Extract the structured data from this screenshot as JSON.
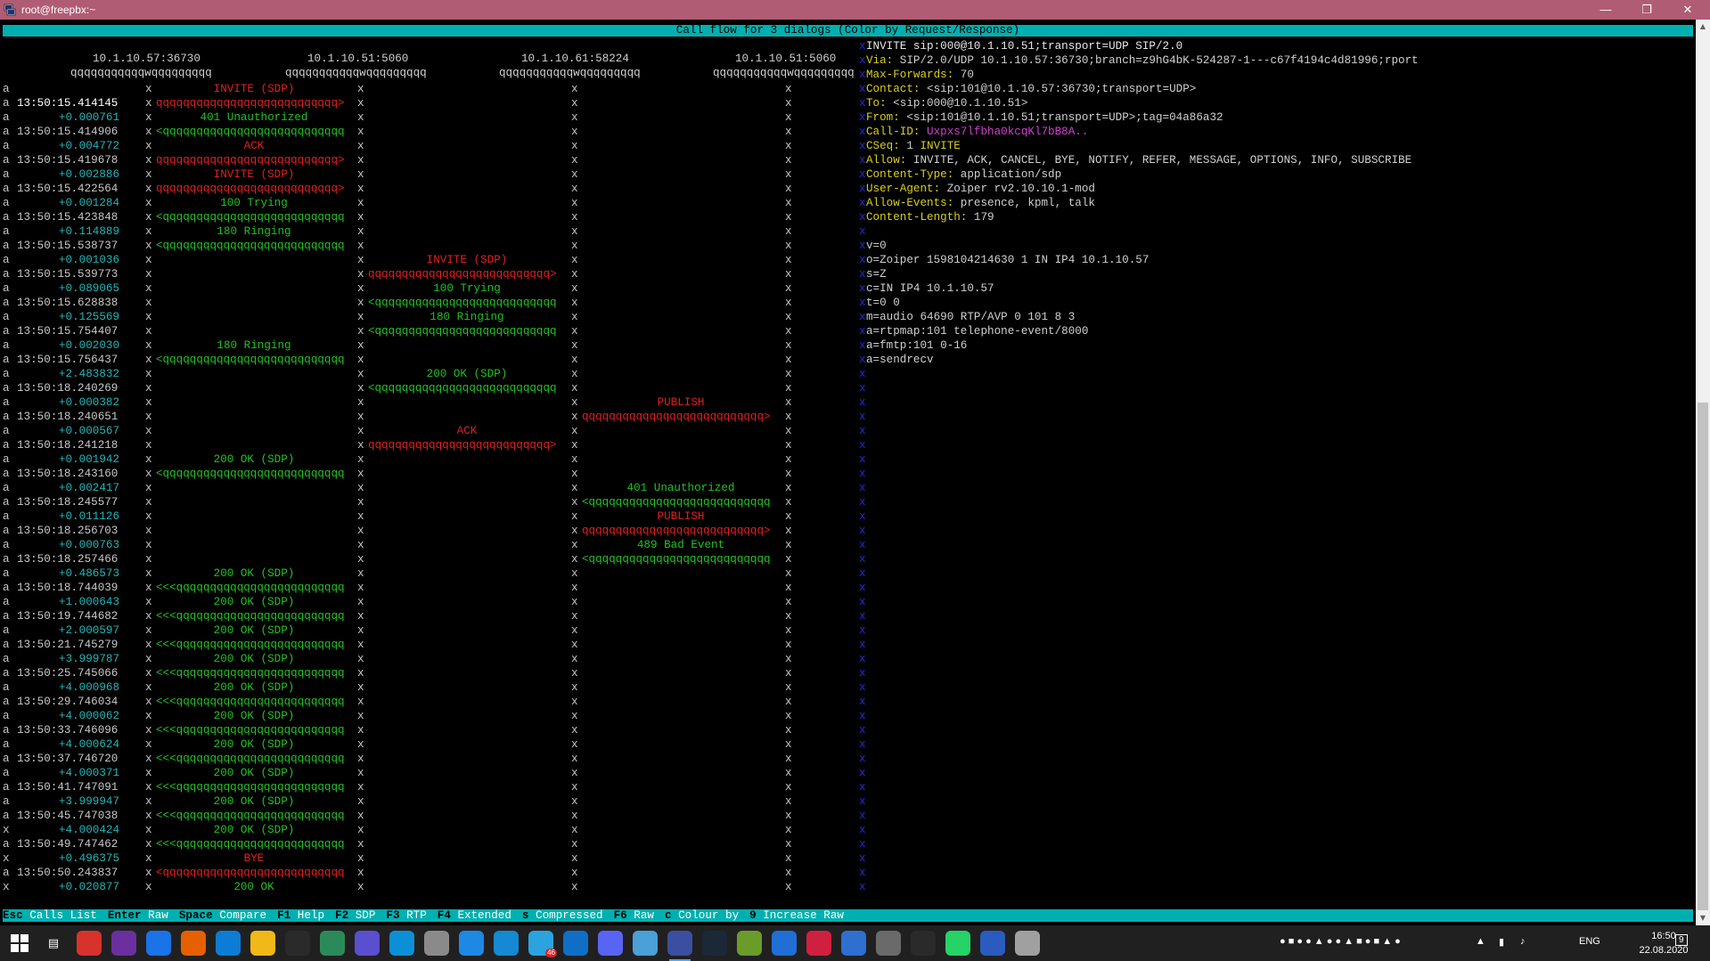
{
  "window": {
    "title": "root@freepbx:~",
    "min_icon": "minimize-icon",
    "max_icon": "restore-icon",
    "close_icon": "close-icon"
  },
  "header": {
    "text": "Call flow for 3 dialogs (Color by Request/Response)"
  },
  "endpoints": [
    "10.1.10.57:36730",
    "10.1.10.51:5060",
    "10.1.10.61:58224",
    "10.1.10.51:5060"
  ],
  "lifeline": "qqqqqqqqqqqwqqqqqqqqq",
  "flow": [
    {
      "flag": "a",
      "time": "",
      "delta": "",
      "from": 0,
      "to": 1,
      "label": "INVITE (SDP)",
      "color": "red",
      "head": "> ",
      "arrow": ""
    },
    {
      "flag": "a",
      "time": "13:50:15.414145",
      "delta": "",
      "from": 0,
      "to": 1,
      "label": "",
      "color": "red",
      "arrow": "qqqqqqqqqqqqqqqqqqqqqqqqqqq>"
    },
    {
      "flag": "a",
      "time": "",
      "delta": "+0.000761",
      "from": 0,
      "to": 1,
      "label": "401 Unauthorized",
      "color": "green",
      "arrow": ""
    },
    {
      "flag": "a",
      "time": "13:50:15.414906",
      "delta": "",
      "from": 0,
      "to": 1,
      "label": "",
      "color": "green",
      "arrow": "<qqqqqqqqqqqqqqqqqqqqqqqqqqq"
    },
    {
      "flag": "a",
      "time": "",
      "delta": "+0.004772",
      "from": 0,
      "to": 1,
      "label": "ACK",
      "color": "red",
      "arrow": ""
    },
    {
      "flag": "a",
      "time": "13:50:15.419678",
      "delta": "",
      "from": 0,
      "to": 1,
      "label": "",
      "color": "red",
      "arrow": "qqqqqqqqqqqqqqqqqqqqqqqqqqq>"
    },
    {
      "flag": "a",
      "time": "",
      "delta": "+0.002886",
      "from": 0,
      "to": 1,
      "label": "INVITE (SDP)",
      "color": "red",
      "arrow": ""
    },
    {
      "flag": "a",
      "time": "13:50:15.422564",
      "delta": "",
      "from": 0,
      "to": 1,
      "label": "",
      "color": "red",
      "arrow": "qqqqqqqqqqqqqqqqqqqqqqqqqqq>"
    },
    {
      "flag": "a",
      "time": "",
      "delta": "+0.001284",
      "from": 0,
      "to": 1,
      "label": "100 Trying",
      "color": "green",
      "arrow": ""
    },
    {
      "flag": "a",
      "time": "13:50:15.423848",
      "delta": "",
      "from": 0,
      "to": 1,
      "label": "",
      "color": "green",
      "arrow": "<qqqqqqqqqqqqqqqqqqqqqqqqqqq"
    },
    {
      "flag": "a",
      "time": "",
      "delta": "+0.114889",
      "from": 0,
      "to": 1,
      "label": "180 Ringing",
      "color": "green",
      "arrow": ""
    },
    {
      "flag": "a",
      "time": "13:50:15.538737",
      "delta": "",
      "from": 0,
      "to": 1,
      "label": "",
      "color": "green",
      "arrow": "<qqqqqqqqqqqqqqqqqqqqqqqqqqq"
    },
    {
      "flag": "a",
      "time": "",
      "delta": "+0.001036",
      "from": 1,
      "to": 2,
      "label": "INVITE (SDP)",
      "color": "red",
      "arrow": ""
    },
    {
      "flag": "a",
      "time": "13:50:15.539773",
      "delta": "",
      "from": 1,
      "to": 2,
      "label": "",
      "color": "red",
      "arrow": "qqqqqqqqqqqqqqqqqqqqqqqqqqq>"
    },
    {
      "flag": "a",
      "time": "",
      "delta": "+0.089065",
      "from": 1,
      "to": 2,
      "label": "100 Trying",
      "color": "green",
      "arrow": ""
    },
    {
      "flag": "a",
      "time": "13:50:15.628838",
      "delta": "",
      "from": 1,
      "to": 2,
      "label": "",
      "color": "green",
      "arrow": "<qqqqqqqqqqqqqqqqqqqqqqqqqqq"
    },
    {
      "flag": "a",
      "time": "",
      "delta": "+0.125569",
      "from": 1,
      "to": 2,
      "label": "180 Ringing",
      "color": "green",
      "arrow": ""
    },
    {
      "flag": "a",
      "time": "13:50:15.754407",
      "delta": "",
      "from": 1,
      "to": 2,
      "label": "",
      "color": "green",
      "arrow": "<qqqqqqqqqqqqqqqqqqqqqqqqqqq"
    },
    {
      "flag": "a",
      "time": "",
      "delta": "+0.002030",
      "from": 0,
      "to": 1,
      "label": "180 Ringing",
      "color": "green",
      "arrow": ""
    },
    {
      "flag": "a",
      "time": "13:50:15.756437",
      "delta": "",
      "from": 0,
      "to": 1,
      "label": "",
      "color": "green",
      "arrow": "<qqqqqqqqqqqqqqqqqqqqqqqqqqq"
    },
    {
      "flag": "a",
      "time": "",
      "delta": "+2.483832",
      "from": 1,
      "to": 2,
      "label": "200 OK (SDP)",
      "color": "green",
      "arrow": ""
    },
    {
      "flag": "a",
      "time": "13:50:18.240269",
      "delta": "",
      "from": 1,
      "to": 2,
      "label": "",
      "color": "green",
      "arrow": "<qqqqqqqqqqqqqqqqqqqqqqqqqqq"
    },
    {
      "flag": "a",
      "time": "",
      "delta": "+0.000382",
      "from": 2,
      "to": 3,
      "label": "PUBLISH",
      "color": "red",
      "arrow": ""
    },
    {
      "flag": "a",
      "time": "13:50:18.240651",
      "delta": "",
      "from": 2,
      "to": 3,
      "label": "",
      "color": "red",
      "arrow": "qqqqqqqqqqqqqqqqqqqqqqqqqqq>"
    },
    {
      "flag": "a",
      "time": "",
      "delta": "+0.000567",
      "from": 1,
      "to": 2,
      "label": "ACK",
      "color": "red",
      "arrow": ""
    },
    {
      "flag": "a",
      "time": "13:50:18.241218",
      "delta": "",
      "from": 1,
      "to": 2,
      "label": "",
      "color": "red",
      "arrow": "qqqqqqqqqqqqqqqqqqqqqqqqqqq>"
    },
    {
      "flag": "a",
      "time": "",
      "delta": "+0.001942",
      "from": 0,
      "to": 1,
      "label": "200 OK (SDP)",
      "color": "green",
      "arrow": ""
    },
    {
      "flag": "a",
      "time": "13:50:18.243160",
      "delta": "",
      "from": 0,
      "to": 1,
      "label": "",
      "color": "green",
      "arrow": "<qqqqqqqqqqqqqqqqqqqqqqqqqqq"
    },
    {
      "flag": "a",
      "time": "",
      "delta": "+0.002417",
      "from": 2,
      "to": 3,
      "label": "401 Unauthorized",
      "color": "green",
      "arrow": ""
    },
    {
      "flag": "a",
      "time": "13:50:18.245577",
      "delta": "",
      "from": 2,
      "to": 3,
      "label": "",
      "color": "green",
      "arrow": "<qqqqqqqqqqqqqqqqqqqqqqqqqqq"
    },
    {
      "flag": "a",
      "time": "",
      "delta": "+0.011126",
      "from": 2,
      "to": 3,
      "label": "PUBLISH",
      "color": "red",
      "arrow": ""
    },
    {
      "flag": "a",
      "time": "13:50:18.256703",
      "delta": "",
      "from": 2,
      "to": 3,
      "label": "",
      "color": "red",
      "arrow": "qqqqqqqqqqqqqqqqqqqqqqqqqqq>"
    },
    {
      "flag": "a",
      "time": "",
      "delta": "+0.000763",
      "from": 2,
      "to": 3,
      "label": "489 Bad Event",
      "color": "green",
      "arrow": ""
    },
    {
      "flag": "a",
      "time": "13:50:18.257466",
      "delta": "",
      "from": 2,
      "to": 3,
      "label": "",
      "color": "green",
      "arrow": "<qqqqqqqqqqqqqqqqqqqqqqqqqqq"
    },
    {
      "flag": "a",
      "time": "",
      "delta": "+0.486573",
      "from": 0,
      "to": 1,
      "label": "200 OK (SDP)",
      "color": "green",
      "arrow": ""
    },
    {
      "flag": "a",
      "time": "13:50:18.744039",
      "delta": "",
      "from": 0,
      "to": 1,
      "label": "",
      "color": "green",
      "arrow": "<<<qqqqqqqqqqqqqqqqqqqqqqqqq"
    },
    {
      "flag": "a",
      "time": "",
      "delta": "+1.000643",
      "from": 0,
      "to": 1,
      "label": "200 OK (SDP)",
      "color": "green",
      "arrow": ""
    },
    {
      "flag": "a",
      "time": "13:50:19.744682",
      "delta": "",
      "from": 0,
      "to": 1,
      "label": "",
      "color": "green",
      "arrow": "<<<qqqqqqqqqqqqqqqqqqqqqqqqq"
    },
    {
      "flag": "a",
      "time": "",
      "delta": "+2.000597",
      "from": 0,
      "to": 1,
      "label": "200 OK (SDP)",
      "color": "green",
      "arrow": ""
    },
    {
      "flag": "a",
      "time": "13:50:21.745279",
      "delta": "",
      "from": 0,
      "to": 1,
      "label": "",
      "color": "green",
      "arrow": "<<<qqqqqqqqqqqqqqqqqqqqqqqqq"
    },
    {
      "flag": "a",
      "time": "",
      "delta": "+3.999787",
      "from": 0,
      "to": 1,
      "label": "200 OK (SDP)",
      "color": "green",
      "arrow": ""
    },
    {
      "flag": "a",
      "time": "13:50:25.745066",
      "delta": "",
      "from": 0,
      "to": 1,
      "label": "",
      "color": "green",
      "arrow": "<<<qqqqqqqqqqqqqqqqqqqqqqqqq"
    },
    {
      "flag": "a",
      "time": "",
      "delta": "+4.000968",
      "from": 0,
      "to": 1,
      "label": "200 OK (SDP)",
      "color": "green",
      "arrow": ""
    },
    {
      "flag": "a",
      "time": "13:50:29.746034",
      "delta": "",
      "from": 0,
      "to": 1,
      "label": "",
      "color": "green",
      "arrow": "<<<qqqqqqqqqqqqqqqqqqqqqqqqq"
    },
    {
      "flag": "a",
      "time": "",
      "delta": "+4.000062",
      "from": 0,
      "to": 1,
      "label": "200 OK (SDP)",
      "color": "green",
      "arrow": ""
    },
    {
      "flag": "a",
      "time": "13:50:33.746096",
      "delta": "",
      "from": 0,
      "to": 1,
      "label": "",
      "color": "green",
      "arrow": "<<<qqqqqqqqqqqqqqqqqqqqqqqqq"
    },
    {
      "flag": "a",
      "time": "",
      "delta": "+4.000624",
      "from": 0,
      "to": 1,
      "label": "200 OK (SDP)",
      "color": "green",
      "arrow": ""
    },
    {
      "flag": "a",
      "time": "13:50:37.746720",
      "delta": "",
      "from": 0,
      "to": 1,
      "label": "",
      "color": "green",
      "arrow": "<<<qqqqqqqqqqqqqqqqqqqqqqqqq"
    },
    {
      "flag": "a",
      "time": "",
      "delta": "+4.000371",
      "from": 0,
      "to": 1,
      "label": "200 OK (SDP)",
      "color": "green",
      "arrow": ""
    },
    {
      "flag": "a",
      "time": "13:50:41.747091",
      "delta": "",
      "from": 0,
      "to": 1,
      "label": "",
      "color": "green",
      "arrow": "<<<qqqqqqqqqqqqqqqqqqqqqqqqq"
    },
    {
      "flag": "a",
      "time": "",
      "delta": "+3.999947",
      "from": 0,
      "to": 1,
      "label": "200 OK (SDP)",
      "color": "green",
      "arrow": ""
    },
    {
      "flag": "a",
      "time": "13:50:45.747038",
      "delta": "",
      "from": 0,
      "to": 1,
      "label": "",
      "color": "green",
      "arrow": "<<<qqqqqqqqqqqqqqqqqqqqqqqqq"
    },
    {
      "flag": "x",
      "time": "",
      "delta": "+4.000424",
      "from": 0,
      "to": 1,
      "label": "200 OK (SDP)",
      "color": "green",
      "arrow": ""
    },
    {
      "flag": "a",
      "time": "13:50:49.747462",
      "delta": "",
      "from": 0,
      "to": 1,
      "label": "",
      "color": "green",
      "arrow": "<<<qqqqqqqqqqqqqqqqqqqqqqqqq"
    },
    {
      "flag": "x",
      "time": "",
      "delta": "+0.496375",
      "from": 0,
      "to": 1,
      "label": "BYE",
      "color": "red",
      "arrow": ""
    },
    {
      "flag": "a",
      "time": "13:50:50.243837",
      "delta": "",
      "from": 0,
      "to": 1,
      "label": "",
      "color": "red",
      "arrow": "<qqqqqqqqqqqqqqqqqqqqqqqqqqq"
    },
    {
      "flag": "x",
      "time": "",
      "delta": "+0.020877",
      "from": 0,
      "to": 1,
      "label": "200 OK",
      "color": "green",
      "arrow": ""
    }
  ],
  "detail": [
    {
      "parts": [
        {
          "t": "INVITE sip:000@10.1.10.51;transport=UDP SIP/2.0",
          "c": "y"
        }
      ]
    },
    {
      "parts": [
        {
          "t": "Via:",
          "c": "k"
        },
        {
          "t": " SIP/2.0/UDP 10.1.10.57:36730;branch=z9hG4bK-524287-1---c67f4194c4d81996;rport",
          "c": ""
        }
      ]
    },
    {
      "parts": [
        {
          "t": "Max-Forwards:",
          "c": "k"
        },
        {
          "t": " 70",
          "c": ""
        }
      ]
    },
    {
      "parts": [
        {
          "t": "Contact:",
          "c": "k"
        },
        {
          "t": " <sip:101@10.1.10.57:36730;transport=UDP>",
          "c": ""
        }
      ]
    },
    {
      "parts": [
        {
          "t": "To:",
          "c": "k"
        },
        {
          "t": " <sip:000@10.1.10.51>",
          "c": ""
        }
      ]
    },
    {
      "parts": [
        {
          "t": "From:",
          "c": "k"
        },
        {
          "t": " <sip:101@10.1.10.51;transport=UDP>;tag=04a86a32",
          "c": ""
        }
      ]
    },
    {
      "parts": [
        {
          "t": "Call-ID:",
          "c": "k"
        },
        {
          "t": " Uxpxs7lfbha0kcqKl7bB8A..",
          "c": "m"
        }
      ]
    },
    {
      "parts": [
        {
          "t": "CSeq:",
          "c": "k"
        },
        {
          "t": " 1 ",
          "c": ""
        },
        {
          "t": "INVITE",
          "c": "k"
        }
      ]
    },
    {
      "parts": [
        {
          "t": "Allow:",
          "c": "k"
        },
        {
          "t": " INVITE, ACK, CANCEL, BYE, NOTIFY, REFER, MESSAGE, OPTIONS, INFO, SUBSCRIBE",
          "c": ""
        }
      ]
    },
    {
      "parts": [
        {
          "t": "Content-Type:",
          "c": "k"
        },
        {
          "t": " application/sdp",
          "c": ""
        }
      ]
    },
    {
      "parts": [
        {
          "t": "User-Agent:",
          "c": "k"
        },
        {
          "t": " Zoiper rv2.10.10.1-mod",
          "c": ""
        }
      ]
    },
    {
      "parts": [
        {
          "t": "Allow-Events:",
          "c": "k"
        },
        {
          "t": " presence, kpml, talk",
          "c": ""
        }
      ]
    },
    {
      "parts": [
        {
          "t": "Content-Length:",
          "c": "k"
        },
        {
          "t": " 179",
          "c": ""
        }
      ]
    },
    {
      "parts": []
    },
    {
      "parts": [
        {
          "t": "v=0",
          "c": ""
        }
      ]
    },
    {
      "parts": [
        {
          "t": "o=Zoiper 1598104214630 1 IN IP4 10.1.10.57",
          "c": ""
        }
      ]
    },
    {
      "parts": [
        {
          "t": "s=Z",
          "c": ""
        }
      ]
    },
    {
      "parts": [
        {
          "t": "c=IN IP4 10.1.10.57",
          "c": ""
        }
      ]
    },
    {
      "parts": [
        {
          "t": "t=0 0",
          "c": ""
        }
      ]
    },
    {
      "parts": [
        {
          "t": "m=audio 64690 RTP/AVP 0 101 8 3",
          "c": ""
        }
      ]
    },
    {
      "parts": [
        {
          "t": "a=rtpmap:101 telephone-event/8000",
          "c": ""
        }
      ]
    },
    {
      "parts": [
        {
          "t": "a=fmtp:101 0-16",
          "c": ""
        }
      ]
    },
    {
      "parts": [
        {
          "t": "a=sendrecv",
          "c": ""
        }
      ]
    }
  ],
  "detail_separator": "x",
  "footer": [
    {
      "key": "Esc",
      "label": "Calls List"
    },
    {
      "key": "Enter",
      "label": "Raw"
    },
    {
      "key": "Space",
      "label": "Compare"
    },
    {
      "key": "F1",
      "label": "Help"
    },
    {
      "key": "F2",
      "label": "SDP"
    },
    {
      "key": "F3",
      "label": "RTP"
    },
    {
      "key": "F4",
      "label": "Extended"
    },
    {
      "key": "s",
      "label": "Compressed"
    },
    {
      "key": "F6",
      "label": "Raw"
    },
    {
      "key": "c",
      "label": "Colour by"
    },
    {
      "key": "9",
      "label": "Increase Raw"
    }
  ],
  "taskbar": {
    "apps": [
      "anydesk",
      "podcast",
      "chrome",
      "firefox",
      "edge",
      "explorer",
      "steam-community",
      "vectr",
      "cortana",
      "skype",
      "winbox",
      "edge-blue",
      "skype-blue",
      "telegram",
      "outlook",
      "discord",
      "vpn",
      "putty",
      "steam",
      "greenshot",
      "sourcetree",
      "balloon",
      "app-blue",
      "vmware",
      "epic-games",
      "whatsapp",
      "photoshop",
      "media"
    ],
    "telegram_badge": "46",
    "lang": "ENG",
    "time": "16:50",
    "date": "22.08.2020",
    "notifications": "9"
  }
}
